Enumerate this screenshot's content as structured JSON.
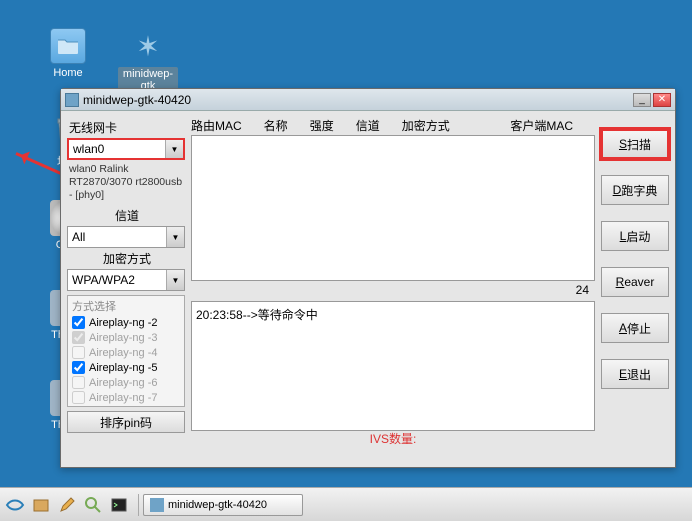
{
  "desktop": {
    "home_label": "Home",
    "app_label": "minidwep-gtk",
    "trash_label": "垃圾",
    "cd_label": "CDLi",
    "thunar1_label": "Thunai",
    "thunar2_label": "Thunai"
  },
  "window": {
    "title": "minidwep-gtk-40420"
  },
  "left": {
    "wireless_label": "无线网卡",
    "adapter_value": "wlan0",
    "adapter_info": "wlan0 Ralink RT2870/3070 rt2800usb - [phy0]",
    "channel_label": "信道",
    "channel_value": "All",
    "enc_label": "加密方式",
    "enc_value": "WPA/WPA2",
    "method_header": "方式选择",
    "methods": [
      {
        "label": "Aireplay-ng -2",
        "checked": true,
        "enabled": true
      },
      {
        "label": "Aireplay-ng -3",
        "checked": true,
        "enabled": false
      },
      {
        "label": "Aireplay-ng -4",
        "checked": false,
        "enabled": false
      },
      {
        "label": "Aireplay-ng -5",
        "checked": true,
        "enabled": true
      },
      {
        "label": "Aireplay-ng -6",
        "checked": false,
        "enabled": false
      },
      {
        "label": "Aireplay-ng -7",
        "checked": false,
        "enabled": false
      }
    ],
    "sort_label": "排序pin码"
  },
  "center": {
    "headers": {
      "router_mac": "路由MAC",
      "name": "名称",
      "strength": "强度",
      "channel": "信道",
      "encryption": "加密方式",
      "client_mac": "客户端MAC"
    },
    "counter": "24",
    "log_line": "20:23:58-->等待命令中",
    "ivs_label": "IVS数量:"
  },
  "right": {
    "scan_u": "S",
    "scan": "扫描",
    "dict_u": "D",
    "dict": "跑字典",
    "start_u": "L",
    "start": "启动",
    "reaver_u": "R",
    "reaver": "eaver",
    "stop_u": "A",
    "stop": "停止",
    "exit_u": "E",
    "exit": "退出"
  },
  "taskbar": {
    "item": "minidwep-gtk-40420"
  }
}
